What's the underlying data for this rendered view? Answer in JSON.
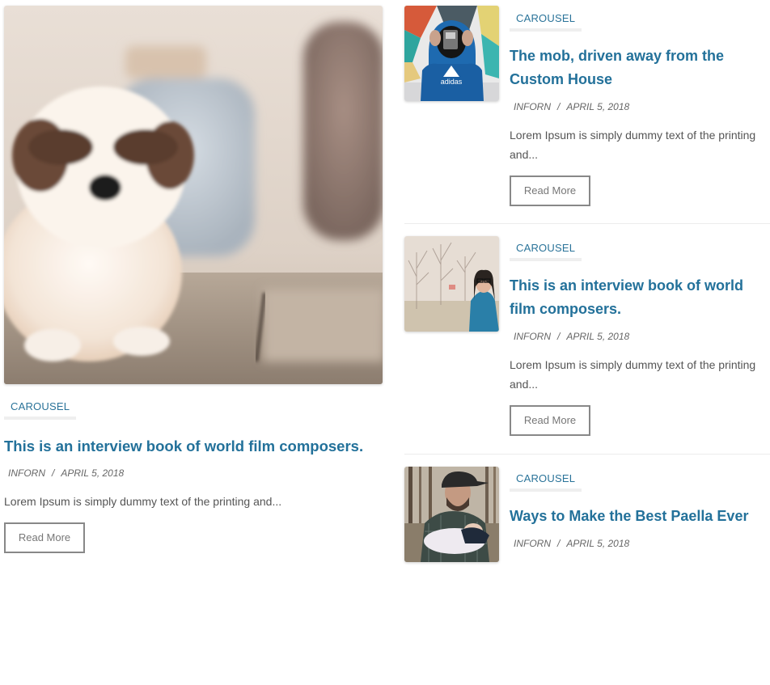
{
  "featured": {
    "image_alt": "Shih Tzu puppy sitting on pavement",
    "category": "CAROUSEL",
    "title": "This is an interview book of world film composers.",
    "author": "INFORN",
    "separator": "/",
    "date": "APRIL 5, 2018",
    "excerpt": "Lorem Ipsum is simply dummy text of the printing and...",
    "button": "Read More"
  },
  "posts": [
    {
      "image_alt": "Person in blue adidas hoodie holding camera",
      "category": "CAROUSEL",
      "title": "The mob, driven away from the Custom House",
      "author": "INFORN",
      "separator": "/",
      "date": "APRIL 5, 2018",
      "excerpt": "Lorem Ipsum is simply dummy text of the printing and...",
      "button": "Read More"
    },
    {
      "image_alt": "Woman with glasses in denim shirt in a park",
      "category": "CAROUSEL",
      "title": "This is an interview book of world film composers.",
      "author": "INFORN",
      "separator": "/",
      "date": "APRIL 5, 2018",
      "excerpt": "Lorem Ipsum is simply dummy text of the printing and...",
      "button": "Read More"
    },
    {
      "image_alt": "Man in cap holding a baby in a forest",
      "category": "CAROUSEL",
      "title": "Ways to Make the Best Paella Ever",
      "author": "INFORN",
      "separator": "/",
      "date": "APRIL 5, 2018"
    }
  ],
  "colors": {
    "accent": "#23719a",
    "category_text": "#2a7399",
    "category_underline": "#efefef",
    "button_border": "#888888",
    "divider": "#ececec"
  }
}
